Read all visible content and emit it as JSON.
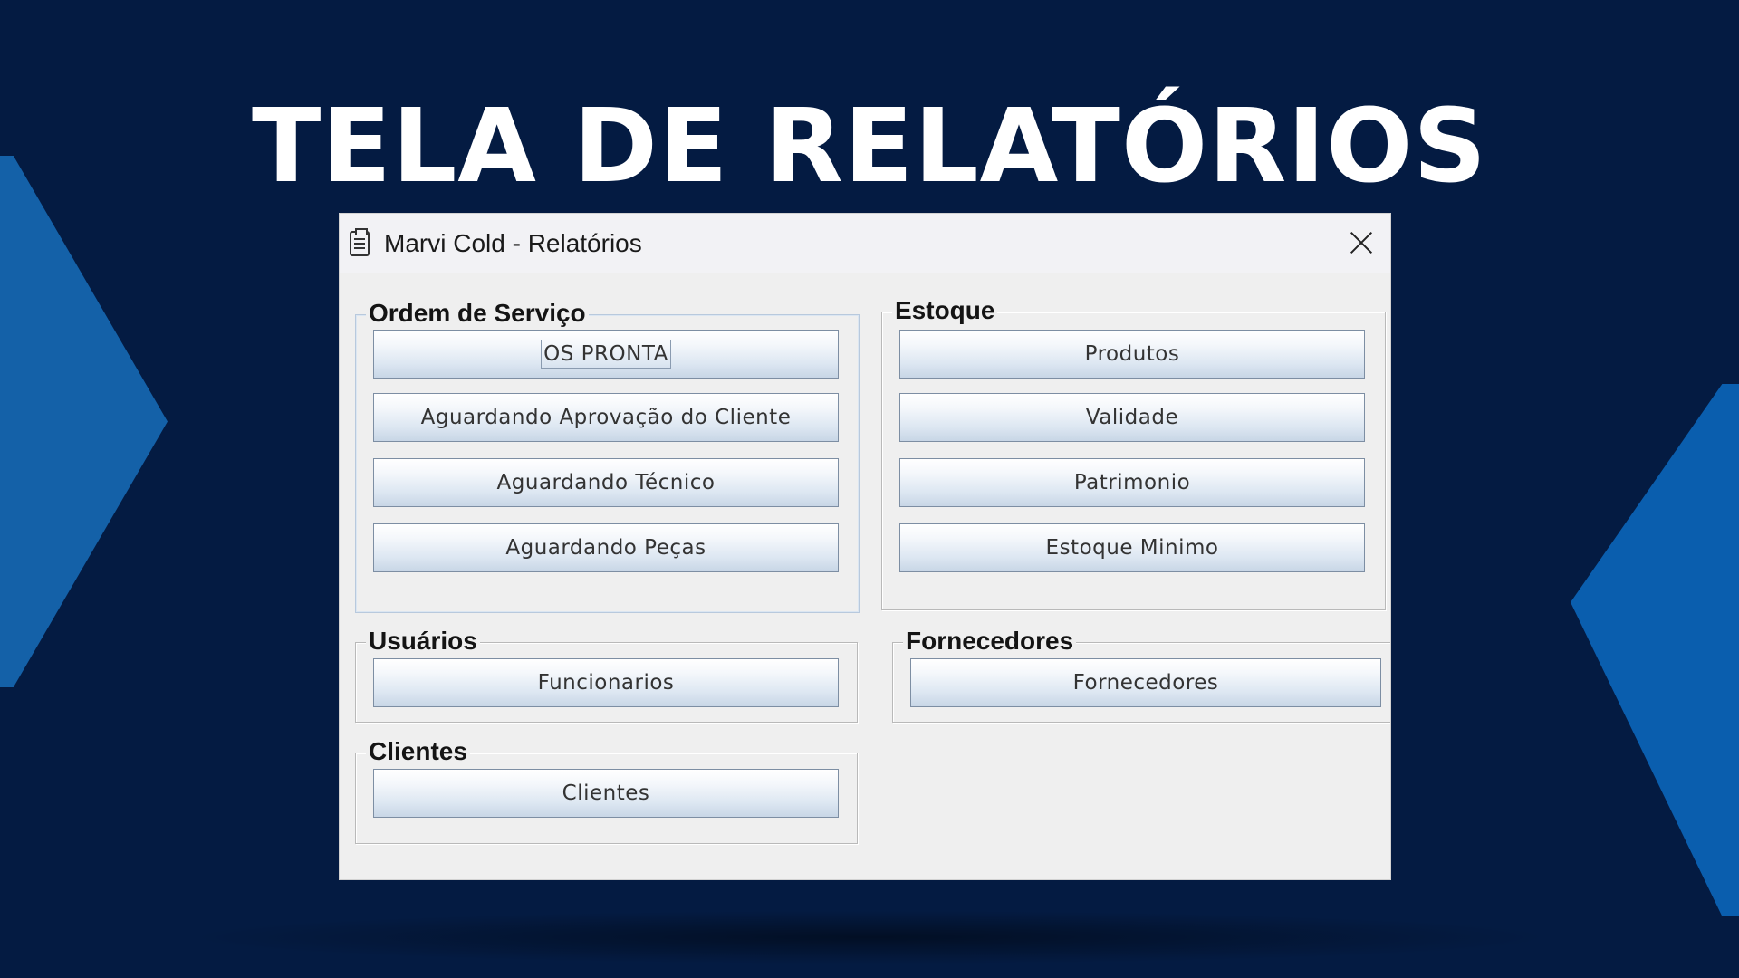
{
  "headline": "TELA DE RELATÓRIOS",
  "window": {
    "title": "Marvi Cold - Relatórios",
    "title_icon": "clipboard-icon",
    "close_icon": "close-icon"
  },
  "groups": {
    "ordem_servico": {
      "title": "Ordem de Serviço",
      "buttons": [
        "OS PRONTA",
        "Aguardando Aprovação do Cliente",
        "Aguardando Técnico",
        "Aguardando Peças"
      ]
    },
    "estoque": {
      "title": "Estoque",
      "buttons": [
        "Produtos",
        "Validade",
        "Patrimonio",
        "Estoque Minimo"
      ]
    },
    "usuarios": {
      "title": "Usuários",
      "buttons": [
        "Funcionarios"
      ]
    },
    "fornecedores": {
      "title": "Fornecedores",
      "buttons": [
        "Fornecedores"
      ]
    },
    "clientes": {
      "title": "Clientes",
      "buttons": [
        "Clientes"
      ]
    }
  },
  "colors": {
    "background": "#041b42",
    "accent_left": "#1461a8",
    "accent_right": "#0a5eae",
    "window_bg": "#efefef"
  }
}
